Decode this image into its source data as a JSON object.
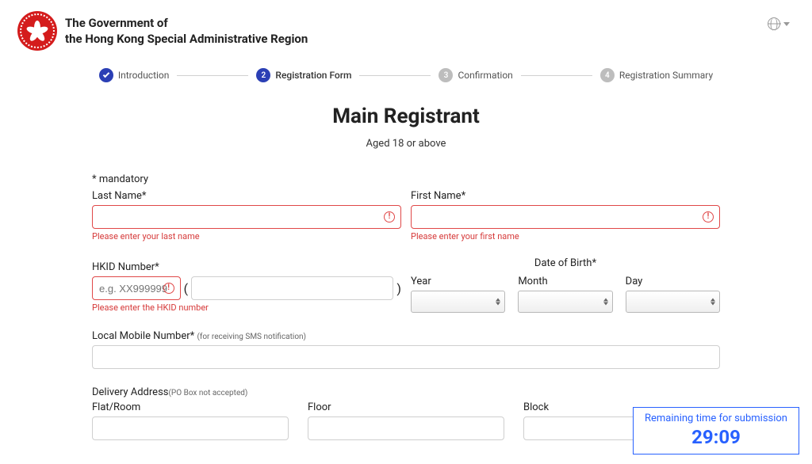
{
  "header": {
    "gov_line1": "The Government of",
    "gov_line2": "the Hong Kong Special Administrative Region"
  },
  "steps": {
    "s1": "Introduction",
    "s2_num": "2",
    "s2": "Registration Form",
    "s3_num": "3",
    "s3": "Confirmation",
    "s4_num": "4",
    "s4": "Registration Summary"
  },
  "page": {
    "title": "Main Registrant",
    "subtitle": "Aged 18 or above",
    "mandatory": "* mandatory"
  },
  "fields": {
    "lastname_label": "Last Name*",
    "lastname_err": "Please enter your last name",
    "firstname_label": "First Name*",
    "firstname_err": "Please enter your first name",
    "hkid_label": "HKID Number*",
    "hkid_placeholder": "e.g. XX999999",
    "hkid_paren_l": "(",
    "hkid_paren_r": ")",
    "hkid_err": "Please enter the HKID number",
    "dob_label": "Date of Birth*",
    "year": "Year",
    "month": "Month",
    "day": "Day",
    "mobile_label": "Local Mobile Number* ",
    "mobile_hint": "(for receiving SMS notification)",
    "delivery_label": "Delivery Address",
    "delivery_hint": "(PO Box not accepted)",
    "flat": "Flat/Room",
    "floor": "Floor",
    "block": "Block"
  },
  "timer": {
    "label": "Remaining time for submission",
    "value": "29:09"
  }
}
